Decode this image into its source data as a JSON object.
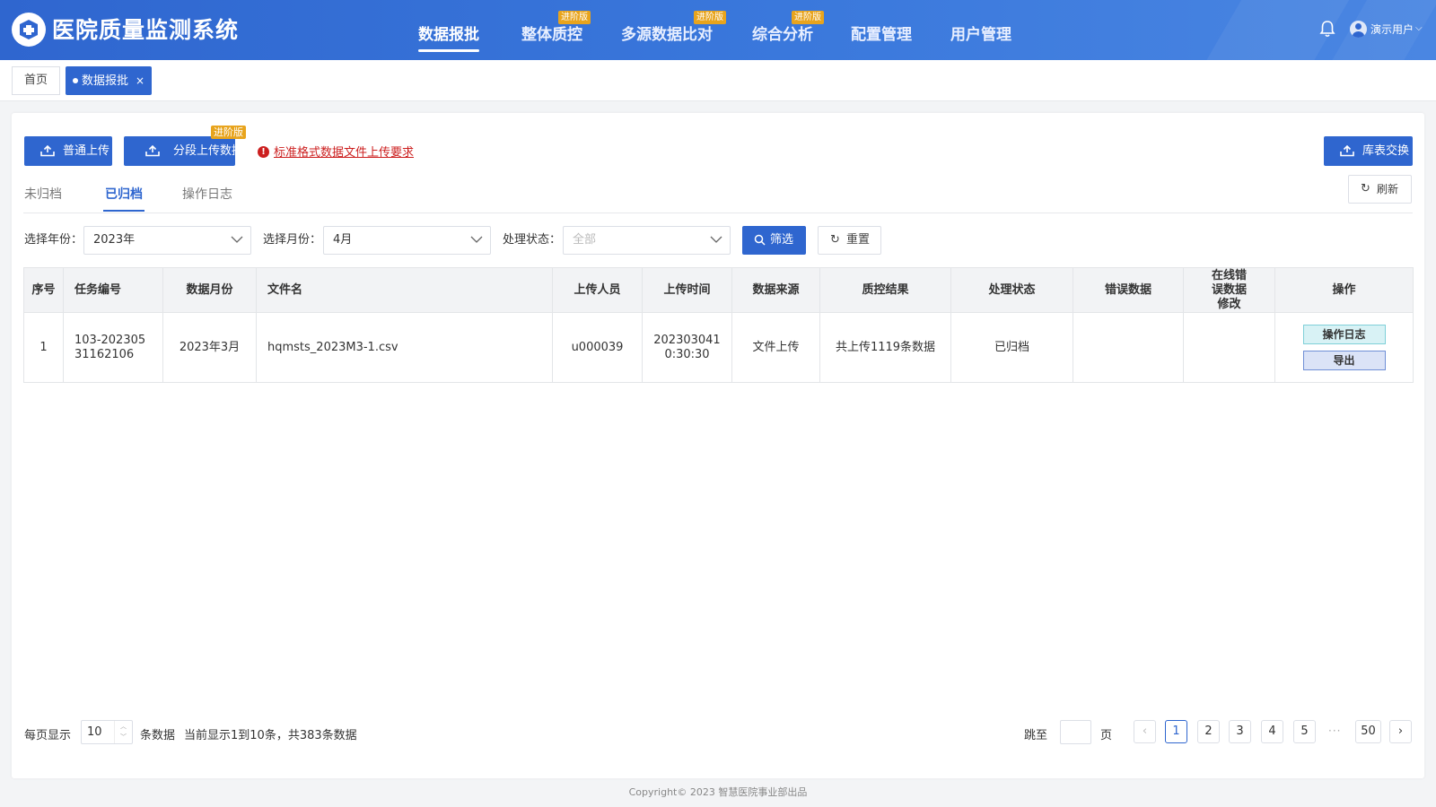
{
  "header": {
    "app_title": "医院质量监测系统",
    "nav": [
      {
        "label": "数据报批",
        "badge": ""
      },
      {
        "label": "整体质控",
        "badge": "进阶版"
      },
      {
        "label": "多源数据比对",
        "badge": "进阶版"
      },
      {
        "label": "综合分析",
        "badge": "进阶版"
      },
      {
        "label": "配置管理",
        "badge": ""
      },
      {
        "label": "用户管理",
        "badge": ""
      }
    ],
    "active_nav": "数据报批",
    "user_name": "演示用户",
    "user_caret": "⌵"
  },
  "tabs": {
    "home": "首页",
    "active": "数据报批",
    "close": "×"
  },
  "toolbar": {
    "normal_upload": "普通上传",
    "segment_upload": "分段上传数据",
    "segment_badge": "进阶版",
    "warn_icon": "!",
    "format_link": "标准格式数据文件上传要求",
    "swap": "库表交换",
    "refresh": "刷新",
    "refresh_icon": "↻"
  },
  "subtabs": [
    "未归档",
    "已归档",
    "操作日志"
  ],
  "active_subtab": "已归档",
  "filters": {
    "year_label": "选择年份：",
    "year_value": "2023年",
    "month_label": "选择月份：",
    "month_value": "4月",
    "status_label": "处理状态：",
    "status_placeholder": "全部",
    "filter_btn": "筛选",
    "reset_btn": "重置",
    "reset_icon": "↻"
  },
  "table": {
    "columns": [
      "序号",
      "任务编号",
      "数据月份",
      "文件名",
      "上传人员",
      "上传时间",
      "数据来源",
      "质控结果",
      "处理状态",
      "错误数据",
      "在线错误数据修改",
      "操作"
    ],
    "rows": [
      {
        "index": "1",
        "task_id": "103-20230531162106",
        "month": "2023年3月",
        "file": "hqmsts_2023M3-1.csv",
        "uploader": "u000039",
        "upload_time": "2023030410:30:30",
        "source": "文件上传",
        "qc_result": "共上传1119条数据",
        "status": "已归档",
        "error_data": "",
        "online_fix": "",
        "op_log": "操作日志",
        "op_export": "导出"
      }
    ]
  },
  "pagination": {
    "per_page_label": "每页显示",
    "per_page_value": "10",
    "spin_up": "︿",
    "spin_down": "﹀",
    "unit": "条数据",
    "summary": "当前显示1到10条，共383条数据",
    "jump_label": "跳至",
    "page_unit": "页",
    "prev": "‹",
    "pages": [
      "1",
      "2",
      "3",
      "4",
      "5"
    ],
    "ellipsis": "···",
    "last": "50",
    "next": "›",
    "current": "1"
  },
  "footer": "Copyright© 2023 智慧医院事业部出品",
  "colors": {
    "primary": "#2f66cf",
    "badge": "#e8a41d",
    "warning": "#cc1f1f"
  }
}
